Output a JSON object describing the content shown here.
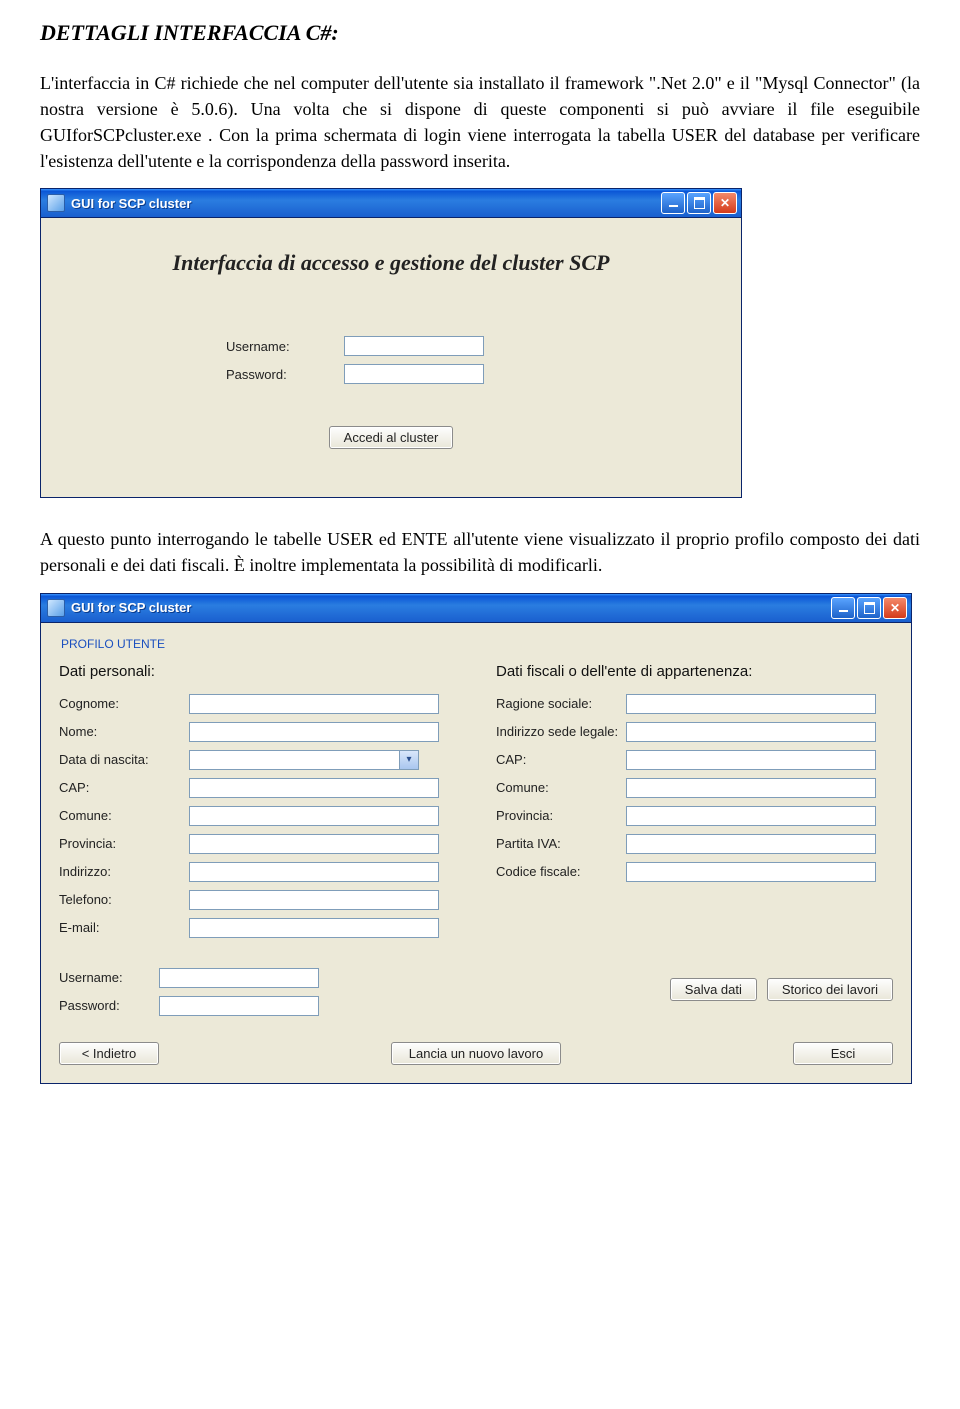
{
  "doc": {
    "heading": "DETTAGLI INTERFACCIA C#:",
    "para1": "L'interfaccia in C# richiede che nel computer dell'utente sia installato il framework \".Net 2.0\" e il \"Mysql Connector\" (la nostra versione è 5.0.6). Una volta che si dispone di queste componenti si può avviare il file eseguibile GUIforSCPcluster.exe . Con la prima schermata di login viene interrogata la tabella USER del database per verificare l'esistenza dell'utente e la corrispondenza della password inserita.",
    "para2": "A questo punto interrogando le tabelle USER ed ENTE all'utente viene visualizzato il proprio profilo composto dei dati personali e dei dati fiscali. È inoltre implementata la possibilità di modificarli."
  },
  "loginWindow": {
    "title": "GUI for SCP cluster",
    "heading": "Interfaccia di accesso e gestione del cluster SCP",
    "usernameLabel": "Username:",
    "passwordLabel": "Password:",
    "usernameValue": "",
    "passwordValue": "",
    "submit": "Accedi al cluster"
  },
  "profileWindow": {
    "title": "GUI for SCP cluster",
    "sectionCaption": "PROFILO UTENTE",
    "personalHeading": "Dati personali:",
    "fiscalHeading": "Dati fiscali o dell'ente di appartenenza:",
    "personal": {
      "cognomeLabel": "Cognome:",
      "nomeLabel": "Nome:",
      "dobLabel": "Data di nascita:",
      "capLabel": "CAP:",
      "comuneLabel": "Comune:",
      "provinciaLabel": "Provincia:",
      "indirizzoLabel": "Indirizzo:",
      "telefonoLabel": "Telefono:",
      "emailLabel": "E-mail:",
      "cognome": "",
      "nome": "",
      "dob": "",
      "cap": "",
      "comune": "",
      "provincia": "",
      "indirizzo": "",
      "telefono": "",
      "email": ""
    },
    "fiscal": {
      "ragioneLabel": "Ragione sociale:",
      "sedeLabel": "Indirizzo sede legale:",
      "capLabel": "CAP:",
      "comuneLabel": "Comune:",
      "provinciaLabel": "Provincia:",
      "pivaLabel": "Partita IVA:",
      "cfLabel": "Codice fiscale:",
      "ragione": "",
      "sede": "",
      "cap": "",
      "comune": "",
      "provincia": "",
      "piva": "",
      "cf": ""
    },
    "cred": {
      "usernameLabel": "Username:",
      "passwordLabel": "Password:",
      "username": "",
      "password": ""
    },
    "buttons": {
      "save": "Salva dati",
      "history": "Storico dei lavori",
      "back": "<  Indietro",
      "launch": "Lancia un nuovo lavoro",
      "exit": "Esci"
    }
  }
}
